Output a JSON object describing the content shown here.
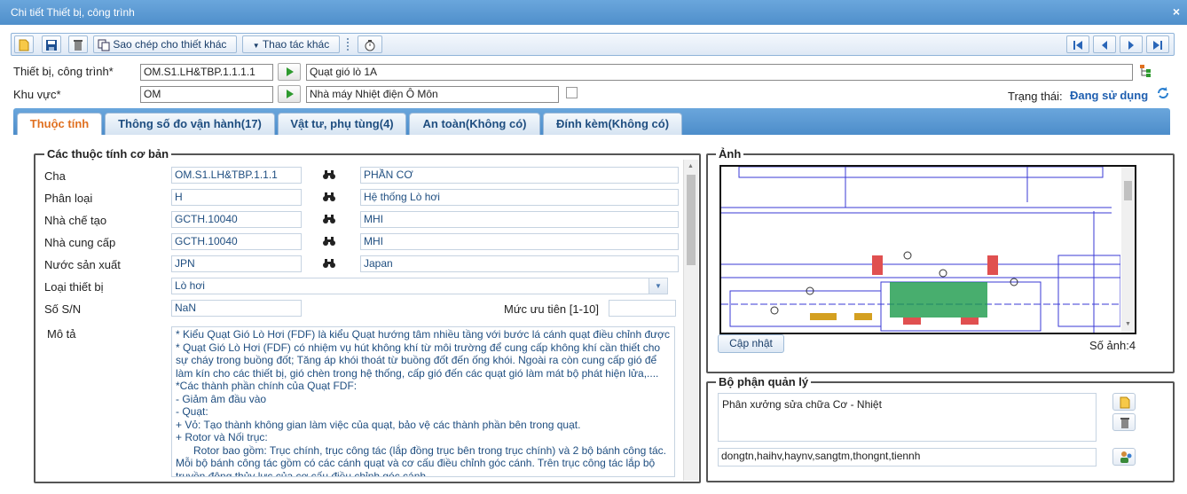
{
  "window": {
    "title": "Chi tiết Thiết bị, công trình",
    "close": "×"
  },
  "toolbar": {
    "copy_label": "Sao chép cho thiết khác",
    "more_label": "Thao tác khác"
  },
  "header": {
    "equipment_label": "Thiết bị, công trình*",
    "equipment_code": "OM.S1.LH&TBP.1.1.1.1",
    "equipment_name": "Quạt gió lò 1A",
    "area_label": "Khu vực*",
    "area_code": "OM",
    "area_name": "Nhà máy Nhiệt điện Ô Môn",
    "status_label": "Trạng thái:",
    "status_value": "Đang sử dụng"
  },
  "tabs": [
    {
      "label": "Thuộc tính"
    },
    {
      "label": "Thông số đo vận hành(17)"
    },
    {
      "label": "Vật tư, phụ tùng(4)"
    },
    {
      "label": "An toàn(Không có)"
    },
    {
      "label": "Đính kèm(Không có)"
    }
  ],
  "props": {
    "legend": "Các thuộc tính cơ bản",
    "rows": [
      {
        "label": "Cha",
        "code": "OM.S1.LH&TBP.1.1.1",
        "name": "PHẦN CƠ"
      },
      {
        "label": "Phân loại",
        "code": "H",
        "name": "Hệ thống Lò hơi"
      },
      {
        "label": "Nhà chế tạo",
        "code": "GCTH.10040",
        "name": "MHI"
      },
      {
        "label": "Nhà cung cấp",
        "code": "GCTH.10040",
        "name": "MHI"
      },
      {
        "label": "Nước sản xuất",
        "code": "JPN",
        "name": "Japan"
      }
    ],
    "type_label": "Loại thiết bị",
    "type_value": "Lò hơi",
    "sn_label": "Số S/N",
    "sn_value": "NaN",
    "priority_label": "Mức ưu tiên [1-10]",
    "priority_value": "",
    "desc_label": "Mô tả",
    "desc_text": "* Kiểu Quạt Gió Lò Hơi (FDF) là kiểu Quạt hướng tâm nhiều tầng với bước lá cánh quạt điều chỉnh được\n* Quạt Gió Lò Hơi (FDF) có nhiệm vụ hút không khí từ môi trường để cung cấp không khí cần thiết cho sự cháy trong buồng đốt; Tăng áp khói thoát từ buồng đốt đến ống khói. Ngoài ra còn cung cấp gió để làm kín cho các thiết bị, gió chèn trong hệ thống, cấp gió đến các quạt gió làm mát bộ phát hiện lửa,....\n*Các thành phần chính của Quạt FDF:\n- Giảm âm đầu vào\n- Quạt:\n+ Vỏ: Tạo thành không gian làm việc của quạt, bảo vệ các thành phần bên trong quạt.\n+ Rotor và Nối trục:\n      Rotor bao gồm: Trục chính, trục công tác (lắp đồng trục bên trong trục chính) và 2 bộ bánh công tác. Mỗi bộ bánh công tác gồm có các cánh quạt và cơ cấu điều chỉnh góc cánh. Trên trục công tác lắp bộ truyền động thủy lực của cơ cấu điều chỉnh góc cánh."
  },
  "image_panel": {
    "legend": "Ảnh",
    "update_label": "Cập nhật",
    "count_label": "Số ảnh:4"
  },
  "mgmt": {
    "legend": "Bộ phận quản lý",
    "dept": "Phân xưởng sửa chữa Cơ - Nhiệt",
    "users": "dongtn,haihv,haynv,sangtm,thongnt,tiennh"
  }
}
